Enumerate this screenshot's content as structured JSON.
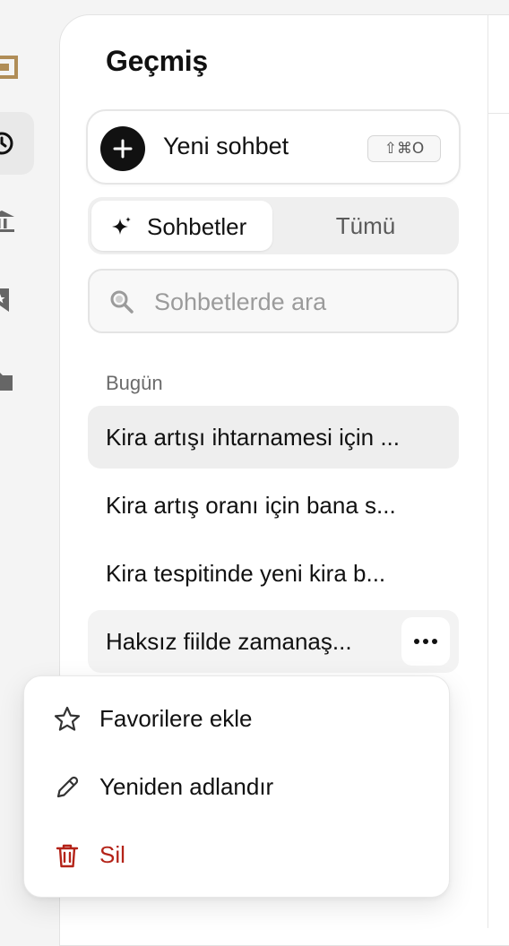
{
  "panel": {
    "title": "Geçmiş"
  },
  "new_chat": {
    "label": "Yeni sohbet",
    "shortcut": "⇧⌘O"
  },
  "segmented": {
    "active": "Sohbetler",
    "other": "Tümü"
  },
  "search": {
    "placeholder": "Sohbetlerde ara",
    "value": ""
  },
  "history": {
    "section_label": "Bugün",
    "items": [
      {
        "title": "Kira artışı ihtarnamesi için ..."
      },
      {
        "title": "Kira artış oranı için bana s..."
      },
      {
        "title": "Kira tespitinde yeni kira b..."
      },
      {
        "title": "Haksız fiilde zamanaş..."
      }
    ]
  },
  "context_menu": {
    "items": [
      {
        "label": "Favorilere ekle",
        "icon": "star-icon"
      },
      {
        "label": "Yeniden adlandır",
        "icon": "pencil-icon"
      },
      {
        "label": "Sil",
        "icon": "trash-icon"
      }
    ]
  },
  "colors": {
    "accent_logo": "#b08d57",
    "danger": "#b42318",
    "dark": "#111111"
  }
}
